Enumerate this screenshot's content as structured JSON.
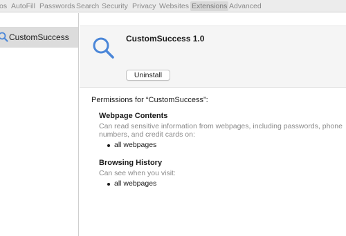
{
  "toolbar": {
    "tabs": [
      {
        "label": "os"
      },
      {
        "label": "AutoFill"
      },
      {
        "label": "Passwords"
      },
      {
        "label": "Search"
      },
      {
        "label": "Security"
      },
      {
        "label": "Privacy"
      },
      {
        "label": "Websites"
      },
      {
        "label": "Extensions"
      },
      {
        "label": "Advanced"
      }
    ],
    "active_tab": "Extensions"
  },
  "sidebar": {
    "items": [
      {
        "label": "CustomSuccess",
        "icon": "magnifier-icon",
        "selected": true
      }
    ]
  },
  "extension": {
    "title": "CustomSuccess 1.0",
    "icon": "magnifier-icon",
    "uninstall_label": "Uninstall"
  },
  "permissions": {
    "heading": "Permissions for “CustomSuccess”:",
    "sections": [
      {
        "title": "Webpage Contents",
        "desc_line1": "Can read sensitive information from webpages, including passwords, phone",
        "desc_line2": "numbers, and credit cards on:",
        "bullet": "all webpages"
      },
      {
        "title": "Browsing History",
        "desc_line1": "Can see when you visit:",
        "bullet": "all webpages"
      }
    ]
  },
  "colors": {
    "accent_icon": "#4a86d8",
    "selected_bg": "#dcdcdc",
    "muted_text": "#8a8a8a"
  }
}
